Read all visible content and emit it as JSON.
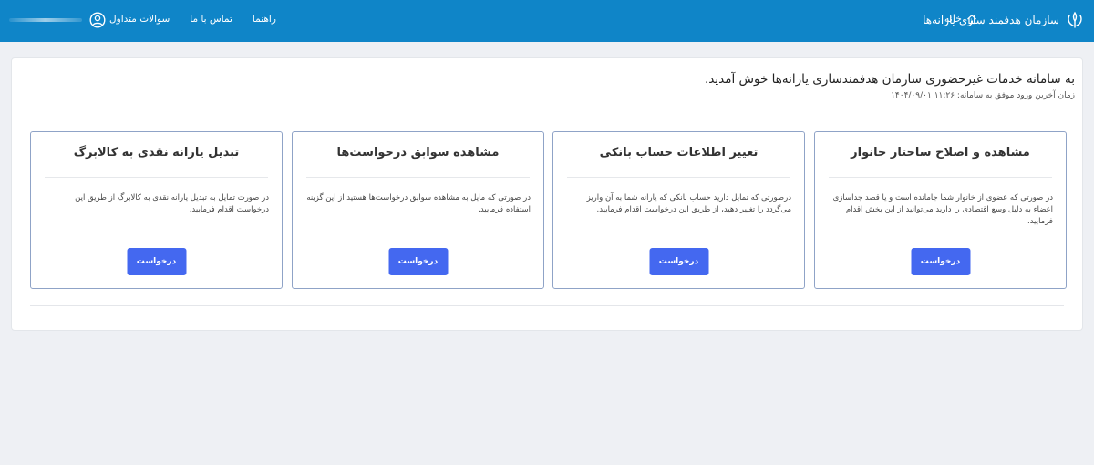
{
  "header": {
    "logo_text": "سازمان هدفمند سازی یارانه‌ها",
    "home_label": "خانه",
    "nav": [
      "سوالات متداول",
      "تماس با ما",
      "راهنما"
    ],
    "colors": {
      "bar": "#0f85c8",
      "accent_button": "#4468f0"
    }
  },
  "main": {
    "welcome": "به سامانه خدمات غیرحضوری سازمان هدفمندسازی یارانه‌ها خوش آمدید.",
    "last_login": "زمان آخرین ورود موفق به سامانه: ۱۱:۲۶ ۱۴۰۴/۰۹/۰۱",
    "cards": [
      {
        "title": "مشاهده و اصلاح ساختار خانوار",
        "description": "در صورتی که عضوی از خانوار شما جامانده است و یا قصد جداسازی اعضاء به دلیل وسع اقتصادی را دارید می‌توانید از این بخش اقدام فرمایید.",
        "button": "درخواست"
      },
      {
        "title": "تغییر اطلاعات حساب بانکی",
        "description": "درصورتی که تمایل دارید حساب بانکی که یارانه شما به آن واریز می‌گردد را تغییر دهید، از طریق این درخواست اقدام فرمایید.",
        "button": "درخواست"
      },
      {
        "title": "مشاهده سوابق درخواست‌ها",
        "description": "در صورتی که مایل به مشاهده سوابق درخواست‌ها هستید از این گزینه استفاده فرمایید.",
        "button": "درخواست"
      },
      {
        "title": "تبدیل یارانه نقدی به کالابرگ",
        "description": "در صورت تمایل به تبدیل یارانه نقدی به کالابرگ از طریق این درخواست اقدام فرمایید.",
        "button": "درخواست"
      }
    ]
  }
}
